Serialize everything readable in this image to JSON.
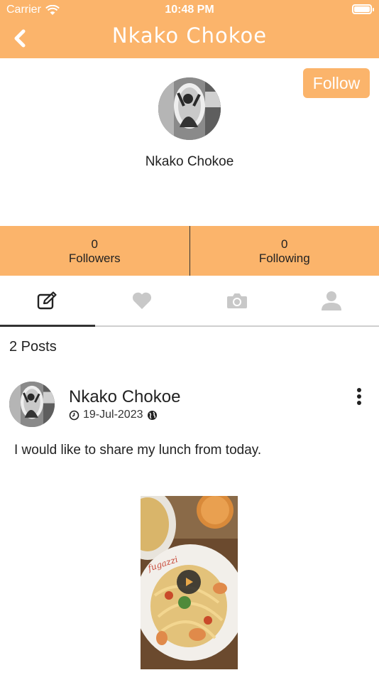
{
  "status_bar": {
    "carrier": "Carrier",
    "time": "10:48 PM"
  },
  "header": {
    "title": "Nkako Chokoe",
    "back_icon": "chevron-left-icon"
  },
  "profile": {
    "name": "Nkako Chokoe",
    "follow_label": "Follow"
  },
  "stats": [
    {
      "count": "0",
      "label": "Followers"
    },
    {
      "count": "0",
      "label": "Following"
    }
  ],
  "tabs": [
    {
      "icon": "edit-icon",
      "active": true
    },
    {
      "icon": "heart-icon",
      "active": false
    },
    {
      "icon": "camera-icon",
      "active": false
    },
    {
      "icon": "user-icon",
      "active": false
    }
  ],
  "posts": {
    "count_label": "2 Posts",
    "items": [
      {
        "author": "Nkako Chokoe",
        "date": "19-Jul-2023",
        "privacy_icon": "globe-icon",
        "text": "I would like to share my lunch from today.",
        "media_type": "video"
      }
    ]
  },
  "colors": {
    "accent": "#fbb46b",
    "tab_active": "#333333",
    "tab_inactive": "#c8c8c8"
  }
}
